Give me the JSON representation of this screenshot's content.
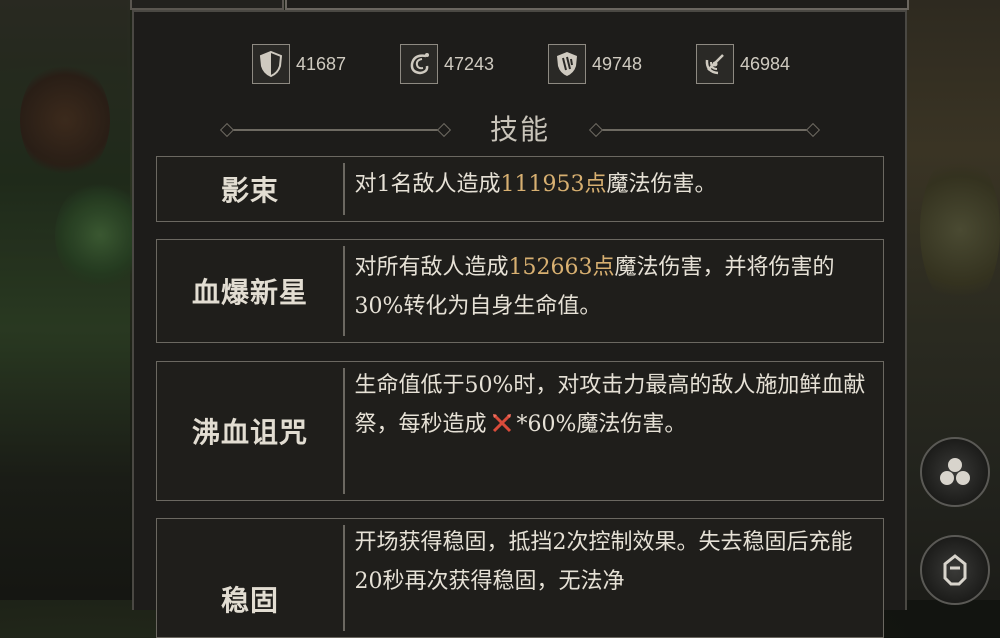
{
  "stats": [
    {
      "icon": "shield-icon",
      "value": "41687"
    },
    {
      "icon": "swirl-icon",
      "value": "47243"
    },
    {
      "icon": "claw-shield-icon",
      "value": "49748"
    },
    {
      "icon": "vortex-icon",
      "value": "46984"
    }
  ],
  "section": {
    "title": "技能"
  },
  "skills": [
    {
      "name": "影束",
      "desc_pre": "对1名敌人造成",
      "desc_hl": "111953点",
      "desc_post": "魔法伤害。"
    },
    {
      "name": "血爆新星",
      "desc_pre": "对所有敌人造成",
      "desc_hl": "152663点",
      "desc_post": "魔法伤害，并将伤害的30%转化为自身生命值。"
    },
    {
      "name": "沸血诅咒",
      "desc_pre": "生命值低于50%时，对攻击力最高的敌人施加鲜血献祭，每秒造成",
      "desc_icon": "crossed-swords-icon",
      "desc_post": "*60%魔法伤害。"
    },
    {
      "name": "稳固",
      "desc_pre": "开场获得稳固，抵挡2次控制效果。失去稳固后充能20秒再次获得稳固，无法净",
      "desc_post": ""
    }
  ],
  "colors": {
    "highlight": "#d8b071",
    "text": "#e6e1d6",
    "border": "#6b6861",
    "sword": "#d94b3a"
  }
}
